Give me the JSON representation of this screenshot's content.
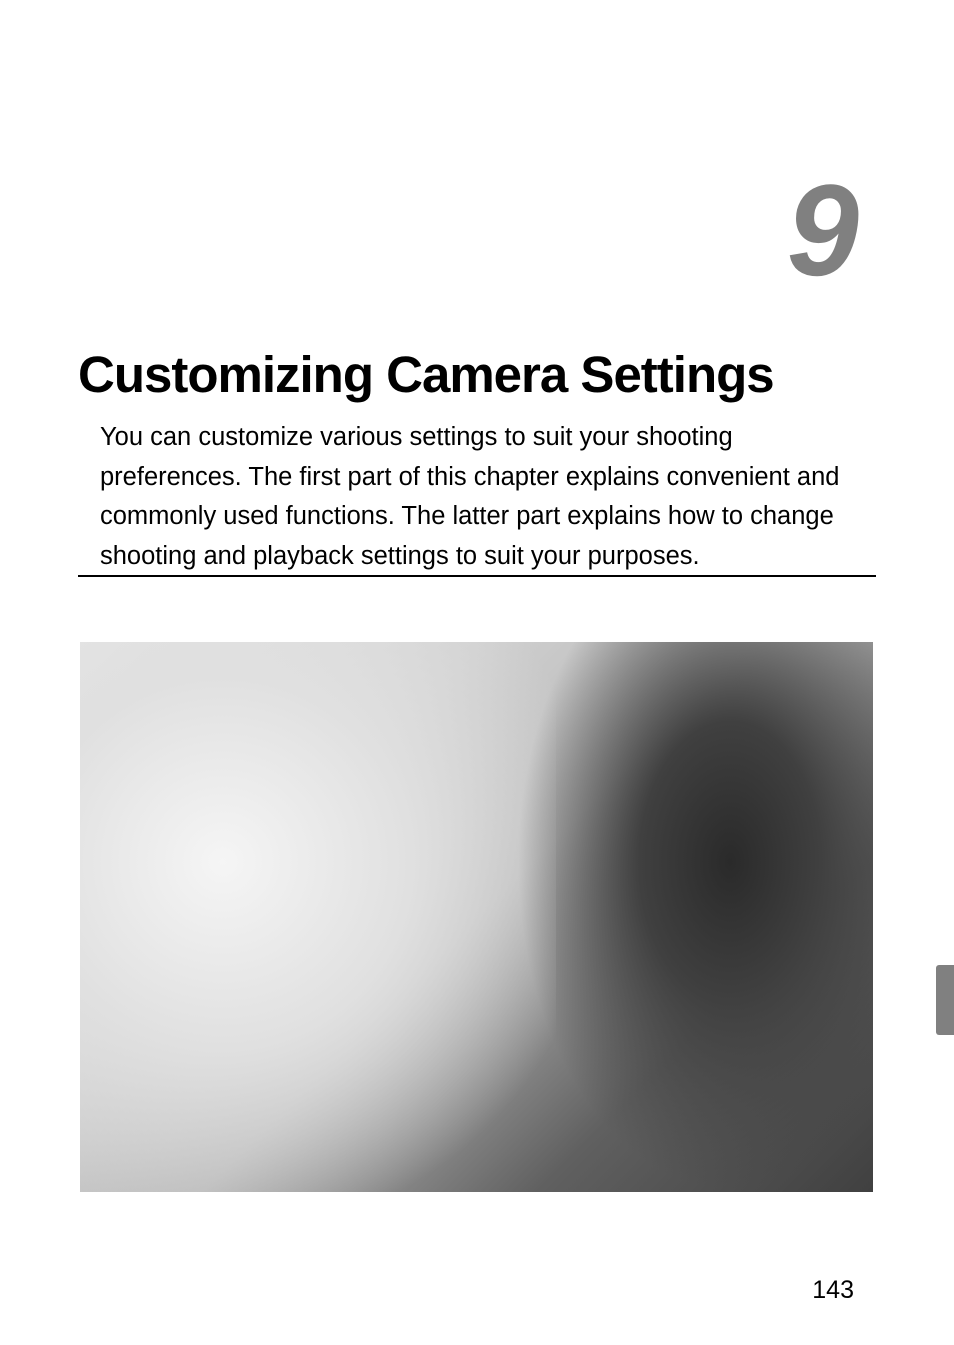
{
  "chapter": {
    "number": "9",
    "title": "Customizing Camera Settings",
    "intro": "You can customize various settings to suit your shooting preferences. The first part of this chapter explains convenient and commonly used functions. The latter part explains how to change shooting and playback settings to suit your purposes."
  },
  "page_number": "143"
}
